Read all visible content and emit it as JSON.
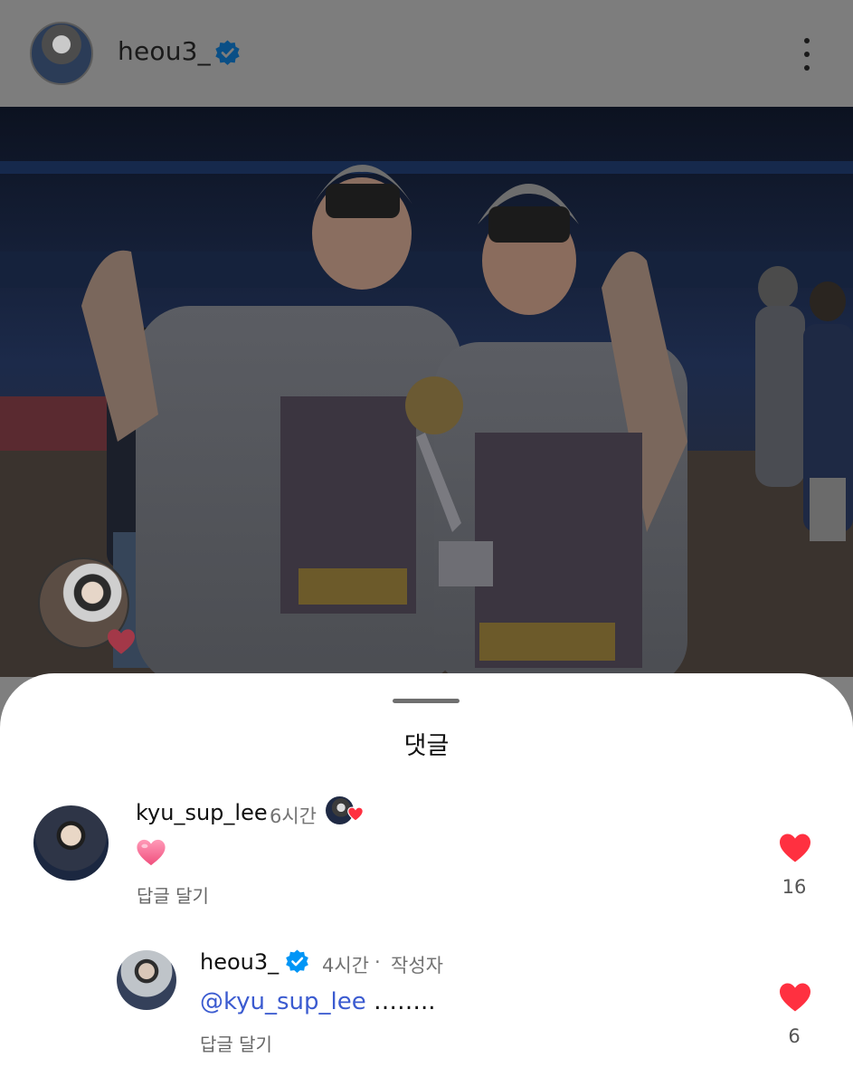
{
  "header": {
    "username": "heou3_",
    "verified": true,
    "avatar_icon": "profile-avatar",
    "more_icon": "more-vertical-icon"
  },
  "photo": {
    "overlay_badge_icon": "heart-icon"
  },
  "sheet": {
    "title": "댓글"
  },
  "comments": [
    {
      "username": "kyu_sup_lee",
      "time": "6시간",
      "text_icon": "pink-heart-emoji",
      "reply_label": "답글 달기",
      "likes": "16",
      "liked": true
    },
    {
      "username": "heou3_",
      "verified": true,
      "time": "4시간",
      "separator": "·",
      "author_label": "작성자",
      "mention": "@kyu_sup_lee",
      "text": " ……..",
      "reply_label": "답글 달기",
      "likes": "6",
      "liked": true
    }
  ],
  "colors": {
    "like_red": "#ff3040",
    "verified_blue": "#0095f6",
    "mention_blue": "#3b5bd0",
    "dim_overlay": "#7d7d7d"
  }
}
